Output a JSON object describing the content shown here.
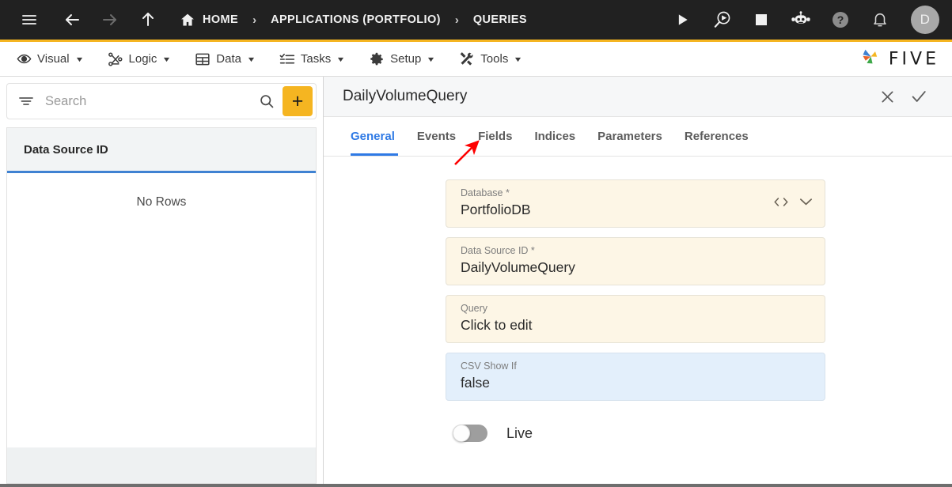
{
  "topbar": {
    "menu_icon": "hamburger-icon",
    "back_icon": "arrow-left-icon",
    "forward_icon": "arrow-right-icon",
    "up_icon": "arrow-up-icon",
    "breadcrumbs": [
      {
        "label": "HOME",
        "icon": "home-icon"
      },
      {
        "label": "APPLICATIONS (PORTFOLIO)",
        "icon": ""
      },
      {
        "label": "QUERIES",
        "icon": ""
      }
    ],
    "separator": "›",
    "actions": [
      {
        "name": "run-icon",
        "title": "Run"
      },
      {
        "name": "debug-icon",
        "title": "Debug"
      },
      {
        "name": "stop-icon",
        "title": "Stop"
      },
      {
        "name": "bot-icon",
        "title": "Assistant"
      },
      {
        "name": "help-icon",
        "title": "Help"
      },
      {
        "name": "bell-icon",
        "title": "Notifications"
      }
    ],
    "avatar_initial": "D",
    "background": "#212121"
  },
  "menubar": {
    "accent_line": "#f5b521",
    "items": [
      {
        "label": "Visual",
        "icon": "eye-icon",
        "caret": "▼"
      },
      {
        "label": "Logic",
        "icon": "logic-nodes-icon",
        "caret": "▼"
      },
      {
        "label": "Data",
        "icon": "table-grid-icon",
        "caret": "▼"
      },
      {
        "label": "Tasks",
        "icon": "checklist-icon",
        "caret": "▼"
      },
      {
        "label": "Setup",
        "icon": "gear-icon",
        "caret": "▼"
      },
      {
        "label": "Tools",
        "icon": "tools-icon",
        "caret": "▼"
      }
    ],
    "brand": "FIVE"
  },
  "sidebar": {
    "search": {
      "value": "",
      "placeholder": "Search"
    },
    "filter_icon": "filter-icon",
    "search_icon": "search-icon",
    "add_label": "+",
    "accent": "#f5b521",
    "grid": {
      "columns": [
        "Data Source ID"
      ],
      "rows": [],
      "empty_text": "No Rows",
      "header_underline": "#3f82d2"
    }
  },
  "main": {
    "title": "DailyVolumeQuery",
    "close_icon": "close-icon",
    "confirm_icon": "check-icon",
    "tabs": [
      {
        "label": "General",
        "active": true
      },
      {
        "label": "Events",
        "active": false
      },
      {
        "label": "Fields",
        "active": false
      },
      {
        "label": "Indices",
        "active": false
      },
      {
        "label": "Parameters",
        "active": false
      },
      {
        "label": "References",
        "active": false
      }
    ],
    "active_tab_color": "#2f7ae5",
    "fields": [
      {
        "label": "Database *",
        "value": "PortfolioDB",
        "style": "cream",
        "icons": [
          "code-icon",
          "chevron-down-icon"
        ]
      },
      {
        "label": "Data Source ID *",
        "value": "DailyVolumeQuery",
        "style": "cream",
        "icons": []
      },
      {
        "label": "Query",
        "value": "Click to edit",
        "style": "cream",
        "icons": []
      },
      {
        "label": "CSV Show If",
        "value": "false",
        "style": "blue",
        "icons": []
      }
    ],
    "toggle": {
      "label": "Live",
      "on": false
    }
  },
  "annotation": {
    "type": "arrow",
    "color": "#fe0000",
    "points_to": "Fields"
  }
}
